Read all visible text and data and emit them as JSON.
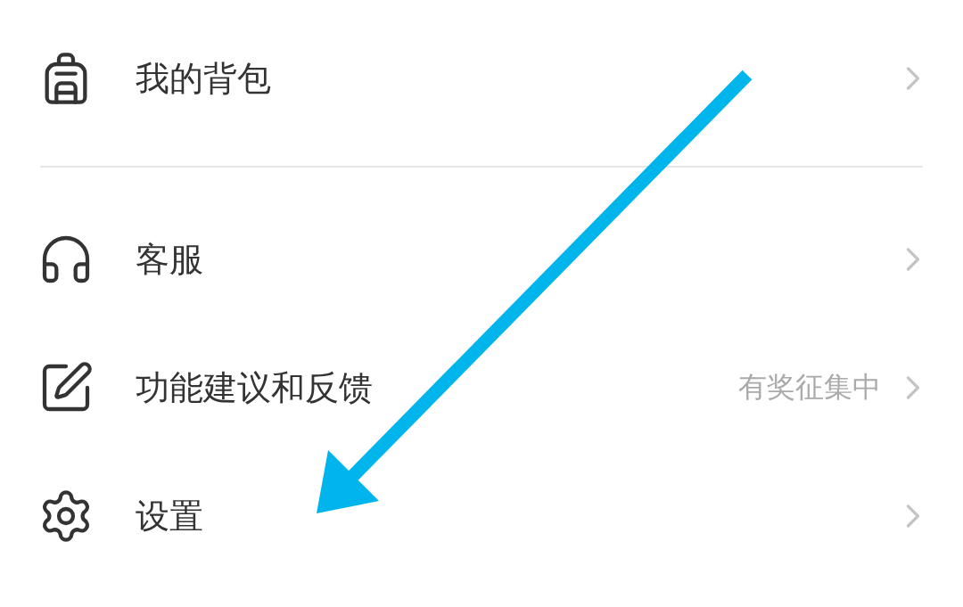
{
  "sections": [
    {
      "items": [
        {
          "label": "我的背包"
        }
      ]
    },
    {
      "items": [
        {
          "label": "客服"
        },
        {
          "label": "功能建议和反馈",
          "hint": "有奖征集中"
        },
        {
          "label": "设置"
        }
      ]
    }
  ]
}
